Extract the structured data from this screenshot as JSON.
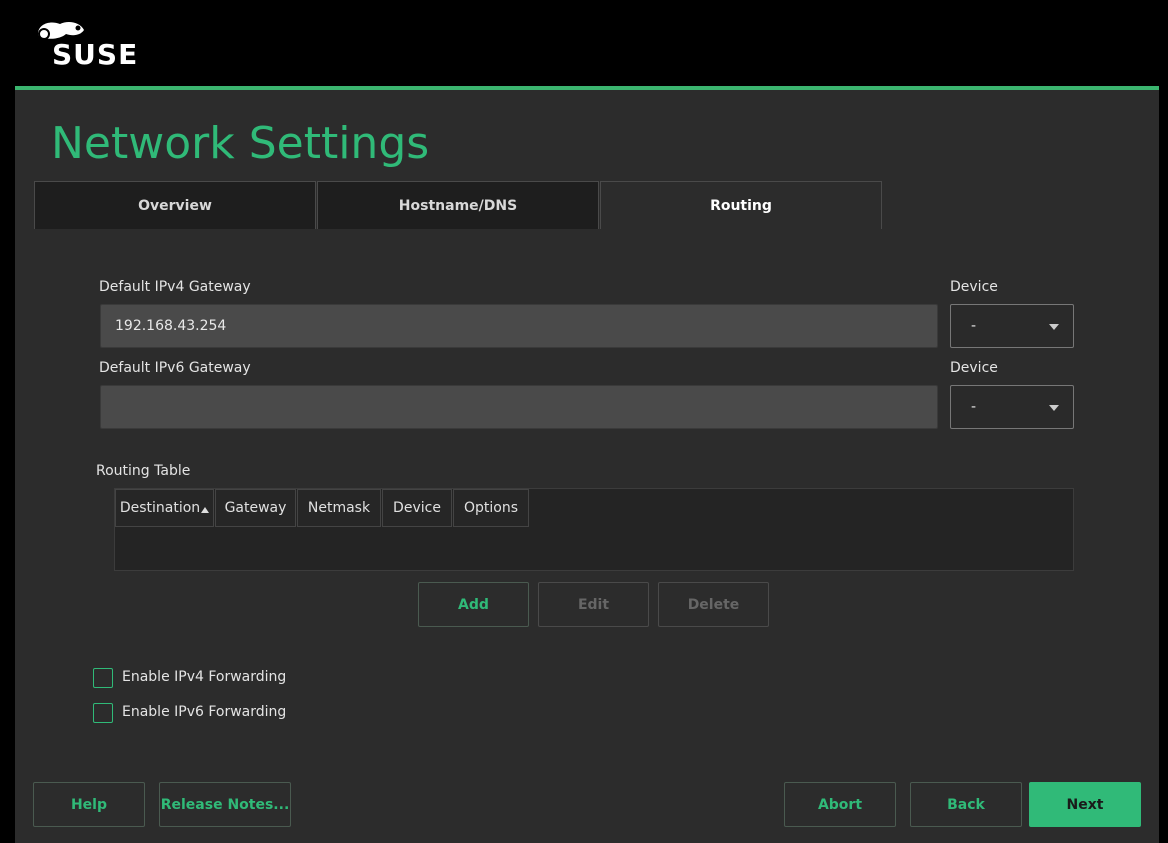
{
  "brand": {
    "name": "SUSE",
    "accent": "#30ba78"
  },
  "page": {
    "title": "Network Settings"
  },
  "tabs": [
    {
      "label": "Overview",
      "active": false
    },
    {
      "label": "Hostname/DNS",
      "active": false
    },
    {
      "label": "Routing",
      "active": true
    }
  ],
  "ipv4": {
    "label": "Default IPv4 Gateway",
    "value": "192.168.43.254",
    "device_label": "Device",
    "device_value": "-"
  },
  "ipv6": {
    "label": "Default IPv6 Gateway",
    "value": "",
    "device_label": "Device",
    "device_value": "-"
  },
  "routing_table": {
    "label": "Routing Table",
    "columns": [
      "Destination",
      "Gateway",
      "Netmask",
      "Device",
      "Options"
    ],
    "rows": []
  },
  "table_buttons": {
    "add": "Add",
    "edit": "Edit",
    "delete": "Delete"
  },
  "forwarding": {
    "ipv4": {
      "label": "Enable IPv4 Forwarding",
      "checked": false
    },
    "ipv6": {
      "label": "Enable IPv6 Forwarding",
      "checked": false
    }
  },
  "footer": {
    "help": "Help",
    "release_notes": "Release Notes...",
    "abort": "Abort",
    "back": "Back",
    "next": "Next"
  }
}
